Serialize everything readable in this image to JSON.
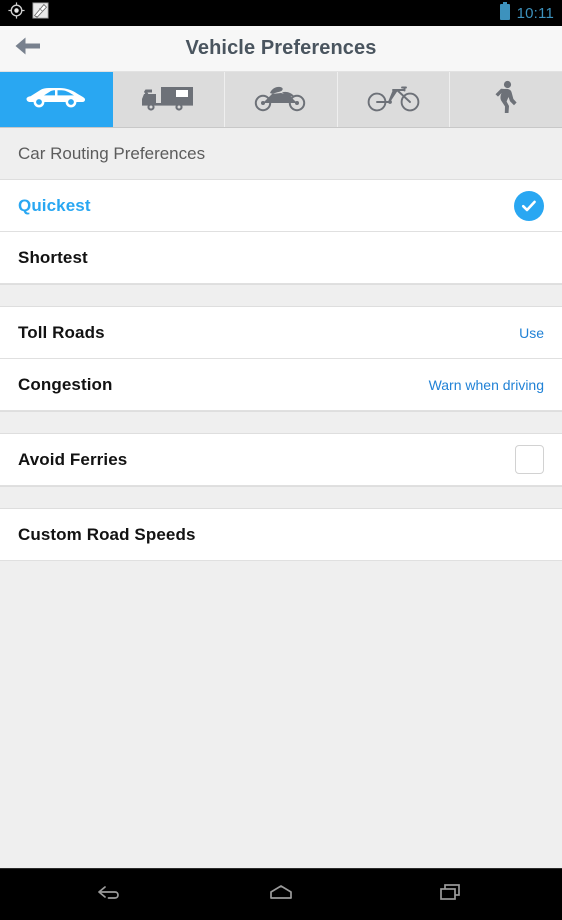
{
  "status_bar": {
    "icons": [
      "gps-location-icon",
      "app-notification-icon"
    ],
    "battery_icon": "battery-icon",
    "time": "10:11",
    "accent_color": "#3d92bd"
  },
  "app_bar": {
    "back_icon": "back-arrow-icon",
    "title": "Vehicle Preferences"
  },
  "tabs": [
    {
      "id": "car",
      "icon": "car-icon",
      "label": "Car",
      "active": true
    },
    {
      "id": "rv",
      "icon": "rv-icon",
      "label": "RV",
      "active": false
    },
    {
      "id": "motorcycle",
      "icon": "motorcycle-icon",
      "label": "Motorcycle",
      "active": false
    },
    {
      "id": "bicycle",
      "icon": "bicycle-icon",
      "label": "Bicycle",
      "active": false
    },
    {
      "id": "pedestrian",
      "icon": "pedestrian-icon",
      "label": "Pedestrian",
      "active": false
    }
  ],
  "section_header": "Car Routing Preferences",
  "rows": {
    "quickest": {
      "label": "Quickest",
      "selected": true
    },
    "shortest": {
      "label": "Shortest",
      "selected": false
    },
    "toll_roads": {
      "label": "Toll Roads",
      "value": "Use"
    },
    "congestion": {
      "label": "Congestion",
      "value": "Warn when driving"
    },
    "avoid_ferries": {
      "label": "Avoid Ferries",
      "checked": false
    },
    "custom_road_speeds": {
      "label": "Custom Road Speeds"
    }
  },
  "nav_bar": {
    "back": "nav-back-icon",
    "home": "nav-home-icon",
    "recents": "nav-recents-icon"
  },
  "colors": {
    "accent_blue": "#29a7f2",
    "value_blue": "#2182d6",
    "title_gray": "#4a555f",
    "tab_inactive": "#dcdcdc",
    "tab_icon_gray": "#6d7178"
  }
}
